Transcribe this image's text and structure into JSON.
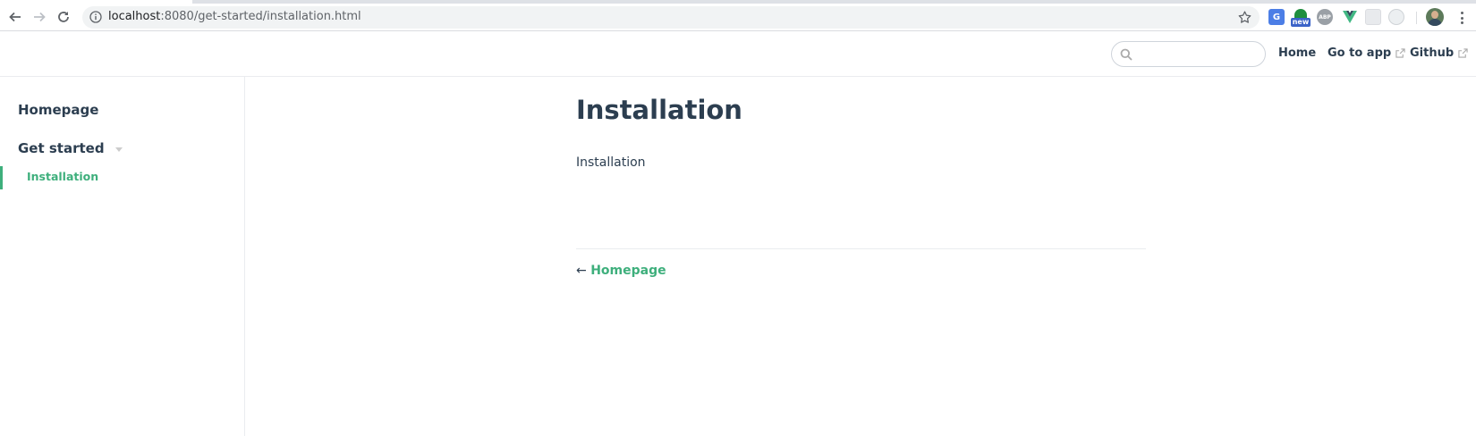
{
  "browser": {
    "url_host": "localhost",
    "url_rest": ":8080/get-started/installation.html",
    "ext_translate_glyph": "G",
    "ext_new_label": "new",
    "ext_abp_label": "ABP"
  },
  "navbar": {
    "search_placeholder": "",
    "links": [
      {
        "label": "Home",
        "external": false
      },
      {
        "label": "Go to app",
        "external": true
      },
      {
        "label": "Github",
        "external": true
      }
    ]
  },
  "sidebar": {
    "home_label": "Homepage",
    "group_label": "Get started",
    "active_item_label": "Installation"
  },
  "content": {
    "title": "Installation",
    "body": "Installation",
    "prev_arrow": "←",
    "prev_label": "Homepage"
  },
  "colors": {
    "accent": "#3eaf7c",
    "text": "#2c3e50",
    "border": "#eaecef"
  }
}
